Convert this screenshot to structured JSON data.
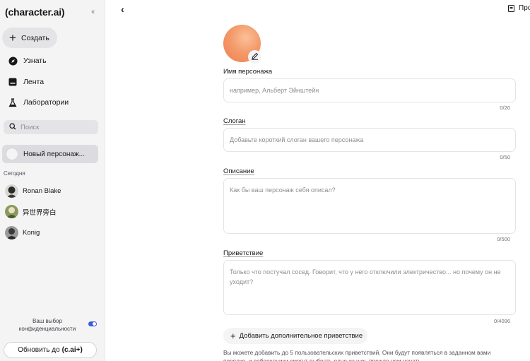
{
  "sidebar": {
    "logo": "(character.ai)",
    "collapse": "‹‹",
    "create_label": "Создать",
    "nav": [
      {
        "label": "Узнать",
        "icon": "compass-icon"
      },
      {
        "label": "Лента",
        "icon": "feed-icon"
      },
      {
        "label": "Лаборатории",
        "icon": "flask-icon"
      }
    ],
    "search_placeholder": "Поиск",
    "new_character": "Новый персонаж...",
    "section_today": "Сегодня",
    "chats": [
      {
        "name": "Ronan Blake",
        "color": "#3a3a3a"
      },
      {
        "name": "异世界旁白",
        "color": "#5a6b3a"
      },
      {
        "name": "Konig",
        "color": "#4a4a4a"
      }
    ],
    "privacy_label": "Ваш выбор конфиденциальности",
    "upgrade_label": "Обновить до",
    "upgrade_brand": "(c.ai+)"
  },
  "header": {
    "back": "‹",
    "right_label": "Про"
  },
  "form": {
    "name": {
      "label": "Имя персонажа",
      "placeholder": "например, Альберт Эйнштейн",
      "counter": "0/20"
    },
    "tagline": {
      "label": "Слоган",
      "placeholder": "Добавьте короткий слоган вашего персонажа",
      "counter": "0/50"
    },
    "description": {
      "label": "Описание",
      "placeholder": "Как бы ваш персонаж себя описал?",
      "counter": "0/500"
    },
    "greeting": {
      "label": "Приветствие",
      "placeholder": "Только что постучал сосед. Говорит, что у него отключили электричество... но почему он не уходит?",
      "counter": "0/4096"
    },
    "add_greeting": "Добавить дополнительное приветствие",
    "hint": "Вы можете добавить до 5 пользовательских приветствий. Они будут появляться в заданном вами порядке, и собеседники смогут выбрать одно из них, прежде чем начать"
  },
  "colors": {
    "accent": "#3b5bdb",
    "avatar": "#f49a6a"
  }
}
